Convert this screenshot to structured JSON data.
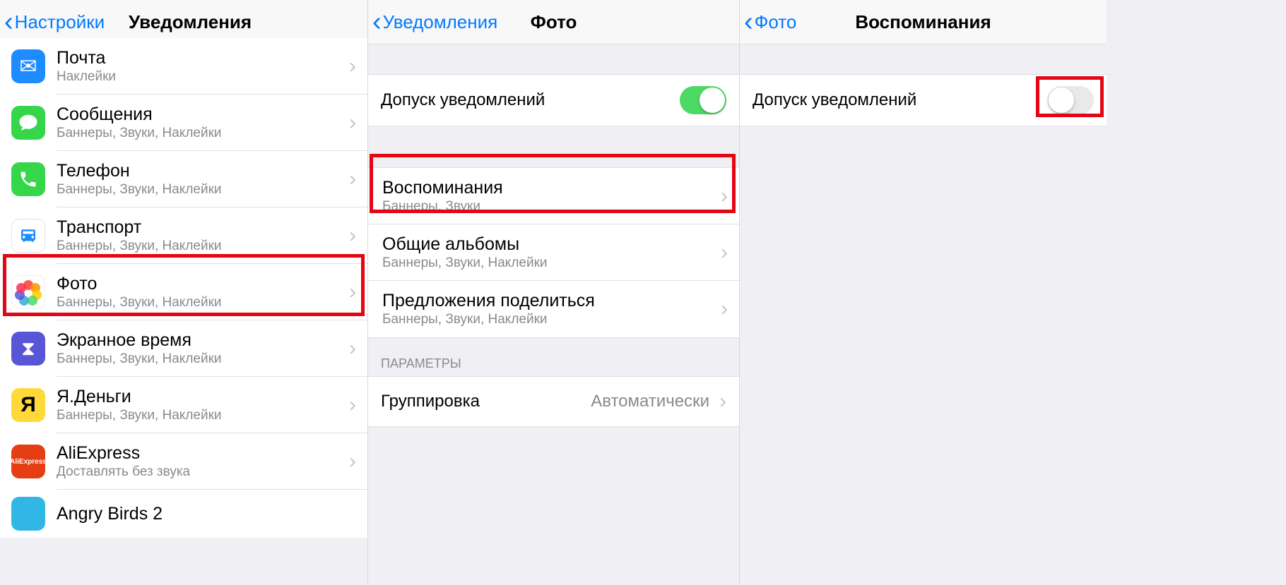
{
  "panel1": {
    "back": "Настройки",
    "title": "Уведомления",
    "items": [
      {
        "label": "Почта",
        "sub": "Наклейки"
      },
      {
        "label": "Сообщения",
        "sub": "Баннеры, Звуки, Наклейки"
      },
      {
        "label": "Телефон",
        "sub": "Баннеры, Звуки, Наклейки"
      },
      {
        "label": "Транспорт",
        "sub": "Баннеры, Звуки, Наклейки"
      },
      {
        "label": "Фото",
        "sub": "Баннеры, Звуки, Наклейки"
      },
      {
        "label": "Экранное время",
        "sub": "Баннеры, Звуки, Наклейки"
      },
      {
        "label": "Я.Деньги",
        "sub": "Баннеры, Звуки, Наклейки"
      },
      {
        "label": "AliExpress",
        "sub": "Доставлять без звука"
      },
      {
        "label": "Angry Birds 2",
        "sub": ""
      }
    ]
  },
  "panel2": {
    "back": "Уведомления",
    "title": "Фото",
    "allow_label": "Допуск уведомлений",
    "items": [
      {
        "label": "Воспоминания",
        "sub": "Баннеры, Звуки"
      },
      {
        "label": "Общие альбомы",
        "sub": "Баннеры, Звуки, Наклейки"
      },
      {
        "label": "Предложения поделиться",
        "sub": "Баннеры, Звуки, Наклейки"
      }
    ],
    "section_header": "ПАРАМЕТРЫ",
    "grouping_label": "Группировка",
    "grouping_value": "Автоматически"
  },
  "panel3": {
    "back": "Фото",
    "title": "Воспоминания",
    "allow_label": "Допуск уведомлений"
  }
}
